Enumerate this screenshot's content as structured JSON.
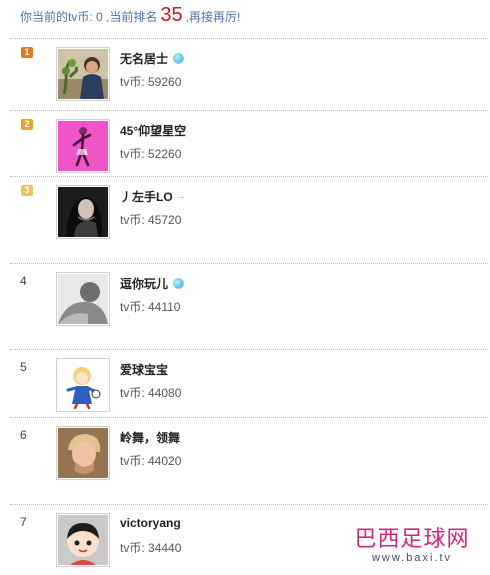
{
  "header": {
    "prefix": "你当前的tv币: 0 ,当前排名",
    "rank": "35",
    "suffix": ",再接再厉!"
  },
  "leaderboard": [
    {
      "rank": "1",
      "name": "无名居士",
      "coins": "tv币: 59260",
      "badge_color": "#e0792c",
      "name_icon": "blue-gem-icon",
      "avatar": "person-plant-photo"
    },
    {
      "rank": "2",
      "name": "45°仰望星空",
      "coins": "tv币: 52260",
      "badge_color": "#e6a52f",
      "name_icon": "",
      "avatar": "pink-dancer-avatar"
    },
    {
      "rank": "3",
      "name": "丿左手LO",
      "coins": "tv币: 45720",
      "badge_color": "#e8c560",
      "name_icon": "arrow-icon",
      "avatar": "dark-portrait-photo"
    },
    {
      "rank": "4",
      "name": "逗你玩儿",
      "coins": "tv币: 44110",
      "badge_color": "",
      "name_icon": "blue-gem-icon",
      "avatar": "grey-portrait-photo"
    },
    {
      "rank": "5",
      "name": "爱球宝宝",
      "coins": "tv币: 44080",
      "badge_color": "",
      "name_icon": "",
      "avatar": "cartoon-girl-avatar"
    },
    {
      "rank": "6",
      "name": "岭舞，领舞",
      "coins": "tv币: 44020",
      "badge_color": "",
      "name_icon": "",
      "avatar": "child-photo"
    },
    {
      "rank": "7",
      "name": "victoryang",
      "coins": "tv币: 34440",
      "badge_color": "",
      "name_icon": "",
      "avatar": "cartoon-boy-avatar"
    }
  ],
  "watermark": {
    "name": "巴西足球网",
    "url": "www.baxi.tv"
  }
}
